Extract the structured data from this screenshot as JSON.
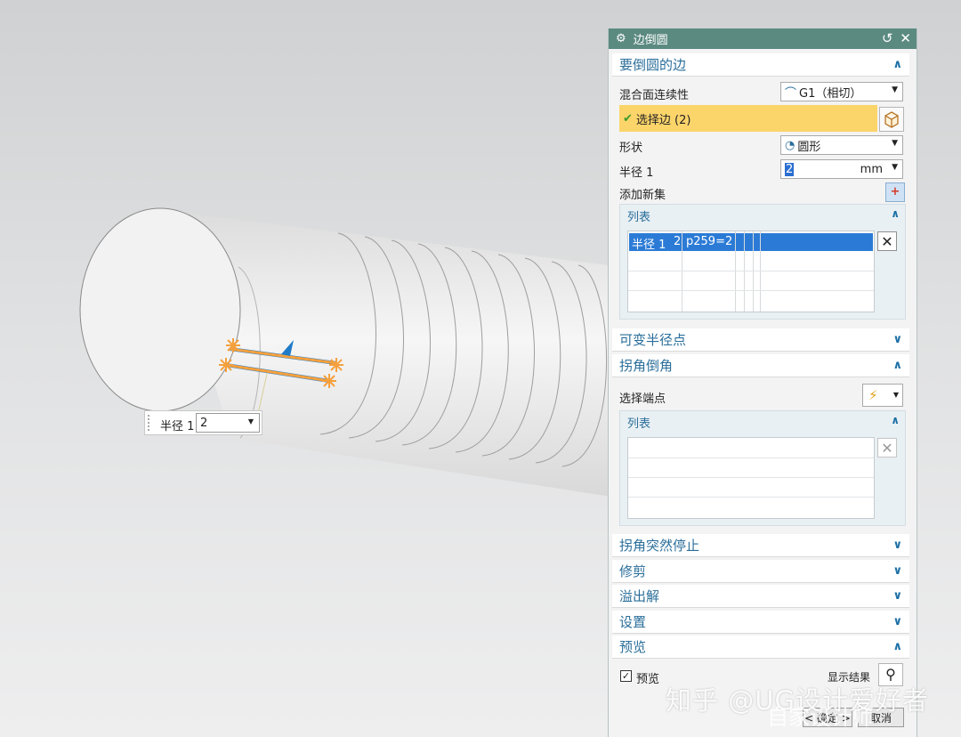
{
  "dialog": {
    "title": "边倒圆",
    "sections": {
      "edge_to_blend": "要倒圆的边",
      "variable_radius": "可变半径点",
      "corner_setback": "拐角倒角",
      "corner_stop": "拐角突然停止",
      "trim": "修剪",
      "overflow": "溢出解",
      "settings": "设置",
      "preview": "预览"
    },
    "blend_continuity_label": "混合面连续性",
    "blend_continuity_value": "G1（相切）",
    "select_edge": "选择边 (2)",
    "shape_label": "形状",
    "shape_value": "圆形",
    "radius_label": "半径 1",
    "radius_value": "2",
    "radius_unit": "mm",
    "add_new_set": "添加新集",
    "list_label": "列表",
    "list_row": {
      "c1": "半径 1",
      "c2": "2",
      "c3": "p259=2"
    },
    "select_endpoint": "选择端点",
    "list2_label": "列表",
    "preview_checkbox": "预览",
    "show_result": "显示结果",
    "ok_button": "< 确定 >",
    "cancel_button": "取消"
  },
  "float_input": {
    "label": "半径 1",
    "value": "2"
  },
  "watermark": {
    "line1": "知乎 @UG设计爱好者",
    "line2": "自家设计师"
  },
  "colors": {
    "title_bg": "#5b8a80",
    "section_text": "#2a6e9a",
    "highlight": "#fbd46a",
    "selection_orange": "#f5a03c"
  }
}
